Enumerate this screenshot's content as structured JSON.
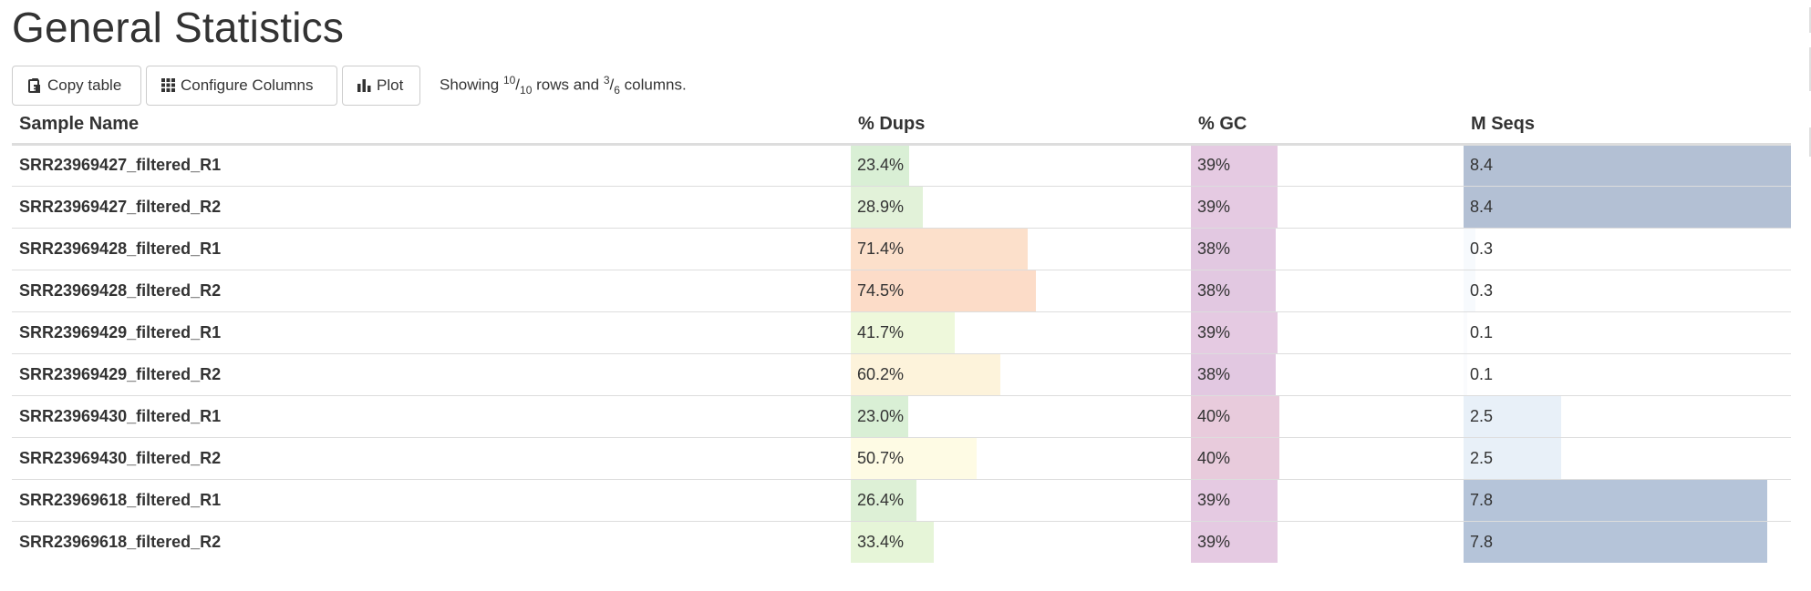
{
  "page": {
    "title": "General Statistics"
  },
  "toolbar": {
    "copy_label": "Copy table",
    "configure_label": "Configure Columns",
    "plot_label": "Plot",
    "showing_prefix": "Showing ",
    "rows_shown": "10",
    "rows_total": "10",
    "rows_word": " rows and ",
    "cols_shown": "3",
    "cols_total": "6",
    "cols_word": " columns."
  },
  "table": {
    "headers": [
      "Sample Name",
      "% Dups",
      "% GC",
      "M Seqs"
    ],
    "rows": [
      {
        "sample": "SRR23969427_filtered_R1",
        "dups": "23.4%",
        "dups_val": 23.4,
        "dups_color": "#d9efd5",
        "gc": "39%",
        "gc_val": 39,
        "gc_color": "#e5cae2",
        "mseqs": "8.4",
        "mseqs_val": 8.4,
        "mseqs_color": "#b3c0d4"
      },
      {
        "sample": "SRR23969427_filtered_R2",
        "dups": "28.9%",
        "dups_val": 28.9,
        "dups_color": "#e2f2d9",
        "gc": "39%",
        "gc_val": 39,
        "gc_color": "#e5cae2",
        "mseqs": "8.4",
        "mseqs_val": 8.4,
        "mseqs_color": "#b3c0d4"
      },
      {
        "sample": "SRR23969428_filtered_R1",
        "dups": "71.4%",
        "dups_val": 71.4,
        "dups_color": "#fce0cb",
        "gc": "38%",
        "gc_val": 38,
        "gc_color": "#e2c8e1",
        "mseqs": "0.3",
        "mseqs_val": 0.3,
        "mseqs_color": "#f7fafd"
      },
      {
        "sample": "SRR23969428_filtered_R2",
        "dups": "74.5%",
        "dups_val": 74.5,
        "dups_color": "#fcdcc8",
        "gc": "38%",
        "gc_val": 38,
        "gc_color": "#e2c8e1",
        "mseqs": "0.3",
        "mseqs_val": 0.3,
        "mseqs_color": "#f7fafd"
      },
      {
        "sample": "SRR23969429_filtered_R1",
        "dups": "41.7%",
        "dups_val": 41.7,
        "dups_color": "#eef8db",
        "gc": "39%",
        "gc_val": 39,
        "gc_color": "#e5cae2",
        "mseqs": "0.1",
        "mseqs_val": 0.1,
        "mseqs_color": "#fafbfd"
      },
      {
        "sample": "SRR23969429_filtered_R2",
        "dups": "60.2%",
        "dups_val": 60.2,
        "dups_color": "#fdf3db",
        "gc": "38%",
        "gc_val": 38,
        "gc_color": "#e2c8e1",
        "mseqs": "0.1",
        "mseqs_val": 0.1,
        "mseqs_color": "#fafbfd"
      },
      {
        "sample": "SRR23969430_filtered_R1",
        "dups": "23.0%",
        "dups_val": 23.0,
        "dups_color": "#d9efd5",
        "gc": "40%",
        "gc_val": 40,
        "gc_color": "#e8cbdc",
        "mseqs": "2.5",
        "mseqs_val": 2.5,
        "mseqs_color": "#e8f0f8"
      },
      {
        "sample": "SRR23969430_filtered_R2",
        "dups": "50.7%",
        "dups_val": 50.7,
        "dups_color": "#fefbe4",
        "gc": "40%",
        "gc_val": 40,
        "gc_color": "#e8cbdc",
        "mseqs": "2.5",
        "mseqs_val": 2.5,
        "mseqs_color": "#e8f0f8"
      },
      {
        "sample": "SRR23969618_filtered_R1",
        "dups": "26.4%",
        "dups_val": 26.4,
        "dups_color": "#ddf0d6",
        "gc": "39%",
        "gc_val": 39,
        "gc_color": "#e5cae2",
        "mseqs": "7.8",
        "mseqs_val": 7.8,
        "mseqs_color": "#b5c4d9"
      },
      {
        "sample": "SRR23969618_filtered_R2",
        "dups": "33.4%",
        "dups_val": 33.4,
        "dups_color": "#e6f5d8",
        "gc": "39%",
        "gc_val": 39,
        "gc_color": "#e5cae2",
        "mseqs": "7.8",
        "mseqs_val": 7.8,
        "mseqs_color": "#b5c4d9"
      }
    ]
  }
}
